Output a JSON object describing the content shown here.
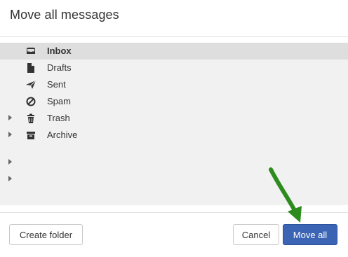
{
  "dialog": {
    "title": "Move all messages"
  },
  "folders": [
    {
      "label": "Inbox",
      "icon": "inbox-icon",
      "selected": true,
      "expandable": false
    },
    {
      "label": "Drafts",
      "icon": "drafts-icon",
      "selected": false,
      "expandable": false
    },
    {
      "label": "Sent",
      "icon": "sent-icon",
      "selected": false,
      "expandable": false
    },
    {
      "label": "Spam",
      "icon": "spam-icon",
      "selected": false,
      "expandable": false
    },
    {
      "label": "Trash",
      "icon": "trash-icon",
      "selected": false,
      "expandable": true
    },
    {
      "label": "Archive",
      "icon": "archive-icon",
      "selected": false,
      "expandable": true
    },
    {
      "label": "",
      "icon": "",
      "selected": false,
      "expandable": true
    },
    {
      "label": "",
      "icon": "",
      "selected": false,
      "expandable": true
    }
  ],
  "footer": {
    "create_label": "Create folder",
    "cancel_label": "Cancel",
    "move_all_label": "Move all"
  },
  "colors": {
    "primary": "#3c64b4",
    "selected_row": "#dedede",
    "tree_background": "#f1f1f1",
    "annotation_arrow": "#2e8b1e"
  }
}
